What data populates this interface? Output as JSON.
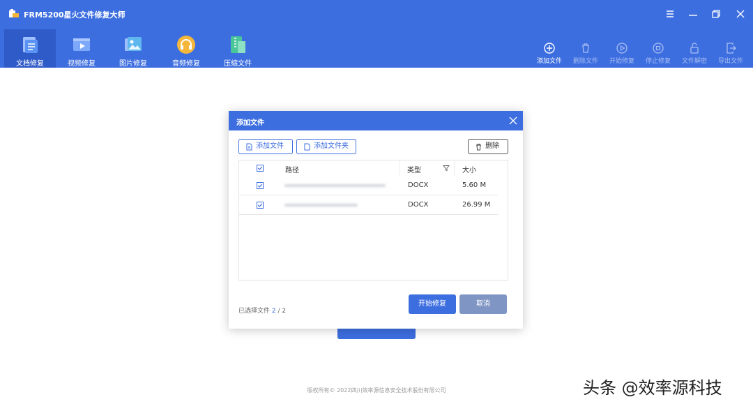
{
  "window": {
    "title": "FRM5200星火文件修复大师",
    "controls": [
      "menu-icon",
      "minimize-icon",
      "maximize-icon",
      "close-icon"
    ]
  },
  "nav_tabs": [
    {
      "label": "文档修复",
      "icon": "document-icon",
      "active": true
    },
    {
      "label": "视频修复",
      "icon": "video-icon",
      "active": false
    },
    {
      "label": "图片修复",
      "icon": "image-icon",
      "active": false
    },
    {
      "label": "音频修复",
      "icon": "headphones-icon",
      "active": false
    },
    {
      "label": "压缩文件",
      "icon": "archive-icon",
      "active": false
    }
  ],
  "toolbar": [
    {
      "label": "添加文件",
      "icon": "add-circle-icon",
      "enabled": true
    },
    {
      "label": "删除文件",
      "icon": "trash-icon",
      "enabled": false
    },
    {
      "label": "开始修复",
      "icon": "play-icon",
      "enabled": false
    },
    {
      "label": "停止修复",
      "icon": "stop-icon",
      "enabled": false
    },
    {
      "label": "文件解密",
      "icon": "unlock-icon",
      "enabled": false
    },
    {
      "label": "导出文件",
      "icon": "export-icon",
      "enabled": false
    }
  ],
  "dialog": {
    "title": "添加文件",
    "add_file_label": "添加文件",
    "add_folder_label": "添加文件夹",
    "delete_label": "删除",
    "columns": {
      "path": "路径",
      "type": "类型",
      "size": "大小"
    },
    "rows": [
      {
        "type": "DOCX",
        "size": "5.60 M",
        "checked": true
      },
      {
        "type": "DOCX",
        "size": "26.99 M",
        "checked": true
      }
    ],
    "selected_label": "已选择文件",
    "selected_count": "2",
    "selected_sep": "/",
    "total_count": "2",
    "start_label": "开始修复",
    "cancel_label": "取消"
  },
  "footer": {
    "copyright": "版权所有© 2022四川效率源信息安全技术股份有限公司"
  },
  "watermark": "头条 @效率源科技",
  "colors": {
    "accent": "#3d6ee0",
    "active_tab": "#2f5bc9",
    "disabled_tool": "#a9bef1",
    "cancel": "#7f96c4"
  }
}
